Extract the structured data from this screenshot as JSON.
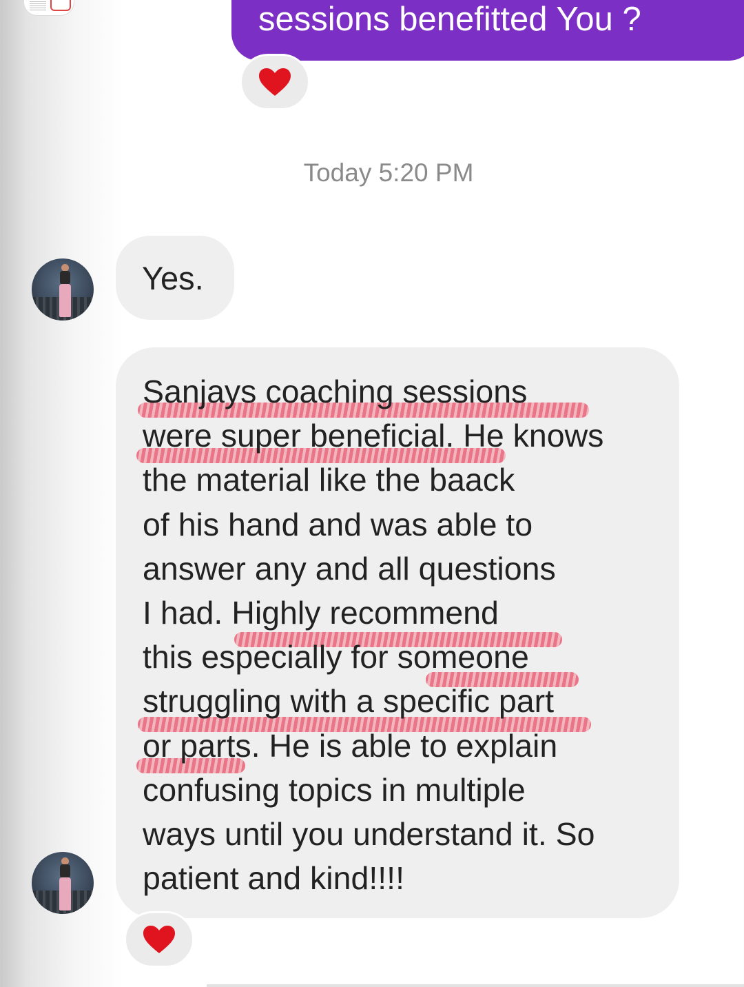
{
  "sent_message": {
    "text": "sessions benefitted You ?"
  },
  "reactions": {
    "sent_reaction": "heart-emoji",
    "received_reaction": "heart-emoji",
    "heart_color": "#e0141f"
  },
  "timestamp": "Today 5:20 PM",
  "received_messages": {
    "short": "Yes.",
    "long_lines": [
      "Sanjays coaching sessions",
      "were super beneficial. He knows",
      "the material like the baack",
      "of his hand and was able to",
      "answer any and all questions",
      "I had. Highly recommend",
      "this especially for someone",
      "struggling with a specific part",
      "or parts. He is able to explain",
      "confusing topics in multiple",
      "ways until you understand it. So",
      "patient and kind!!!!"
    ]
  },
  "colors": {
    "sent_bubble": "#7b2fc4",
    "received_bubble": "#efefef",
    "highlight_scribble": "#e84660"
  }
}
